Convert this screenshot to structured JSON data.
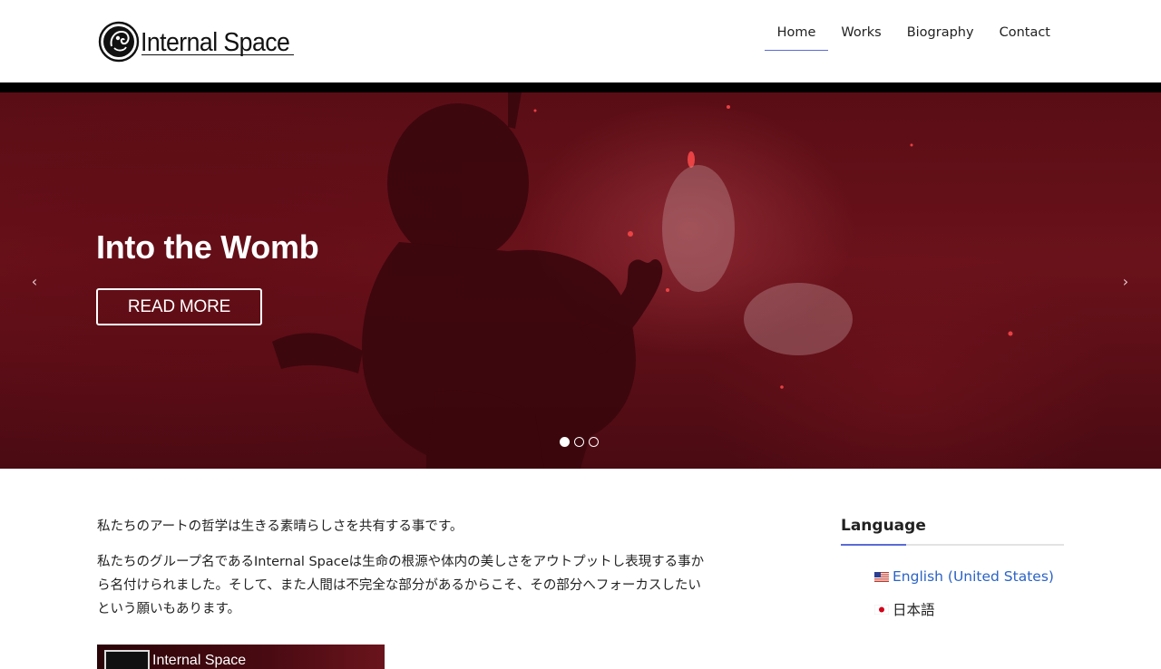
{
  "header": {
    "logo_text": "Internal Space",
    "nav": [
      {
        "label": "Home",
        "active": true
      },
      {
        "label": "Works",
        "active": false
      },
      {
        "label": "Biography",
        "active": false
      },
      {
        "label": "Contact",
        "active": false
      }
    ]
  },
  "hero": {
    "title": "Into the Womb",
    "button_label": "READ MORE",
    "prev_icon": "‹",
    "next_icon": "›",
    "slide_count": 3,
    "active_slide": 1
  },
  "content": {
    "paragraph1": "私たちのアートの哲学は生きる素晴らしさを共有する事です。",
    "paragraph2_line1": "私たちのグループ名であるInternal Spaceは生命の根源や体内の美しさをアウトプットし表現する事か",
    "paragraph2_line2": "ら名付けられました。そして、また人間は不完全な部分があるからこそ、その部分へフォーカスしたい",
    "paragraph2_line3": "という願いもあります。",
    "video_title": "Internal Space"
  },
  "sidebar": {
    "title": "Language",
    "languages": [
      {
        "label": "English (United States)",
        "flag": "us-flag-icon"
      },
      {
        "label": "日本語",
        "flag": "jp-flag-icon"
      }
    ]
  },
  "colors": {
    "accent": "#5a6bd6",
    "link": "#2b63c5",
    "hero_red": "#5a0d15"
  }
}
